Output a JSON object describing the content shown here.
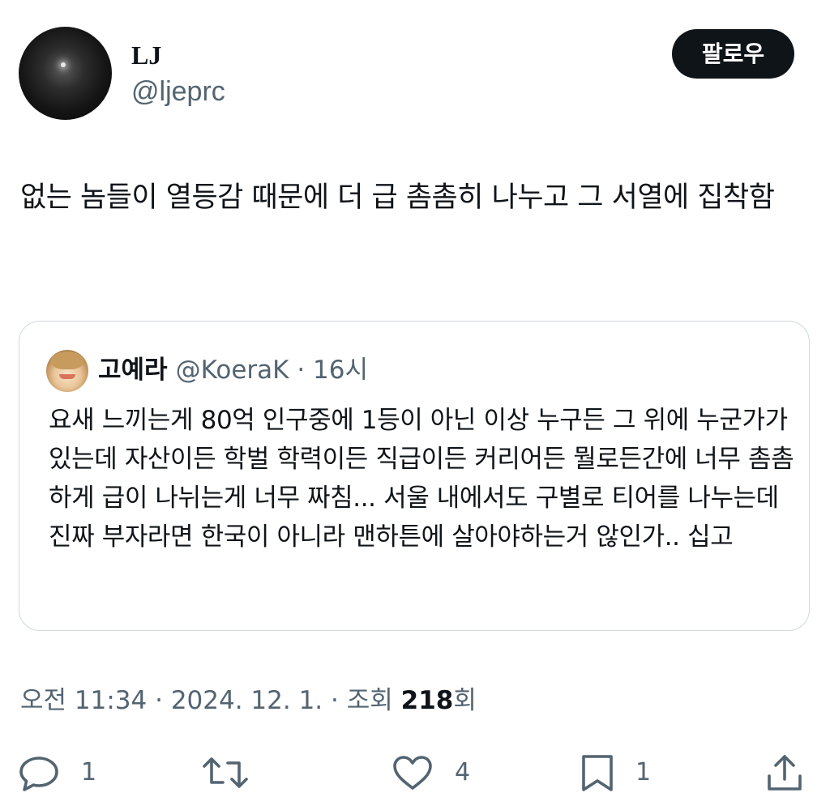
{
  "author": {
    "display_name": "LJ",
    "handle": "@ljeprc",
    "follow_label": "팔로우"
  },
  "tweet": {
    "text": "없는 놈들이 열등감 때문에 더 급 촘촘히 나누고 그 서열에 집착함"
  },
  "quote": {
    "display_name": "고예라",
    "handle": "@KoeraK",
    "separator": "·",
    "time": "16시",
    "text": "요새 느끼는게 80억 인구중에 1등이 아닌 이상 누구든 그 위에 누군가가 있는데 자산이든 학벌 학력이든 직급이든 커리어든 뭘로든간에 너무 촘촘하게 급이 나뉘는게 너무 짜침... 서울 내에서도 구별로 티어를 나누는데 진짜 부자라면 한국이 아니라 맨하튼에 살아야하는거 않인가.. 십고"
  },
  "meta": {
    "time": "오전 11:34",
    "date": "2024. 12. 1.",
    "views_prefix": "조회",
    "views_count": "218",
    "views_suffix": "회",
    "separator": "·"
  },
  "actions": {
    "reply_count": "1",
    "retweet_count": "",
    "like_count": "4",
    "bookmark_count": "1"
  },
  "icons": {
    "reply": "reply-icon",
    "retweet": "retweet-icon",
    "like": "heart-icon",
    "bookmark": "bookmark-icon",
    "share": "share-icon"
  },
  "colors": {
    "text": "#0f1419",
    "secondary": "#536471",
    "border": "#cfd9de",
    "button_bg": "#0f1419",
    "button_text": "#ffffff"
  }
}
